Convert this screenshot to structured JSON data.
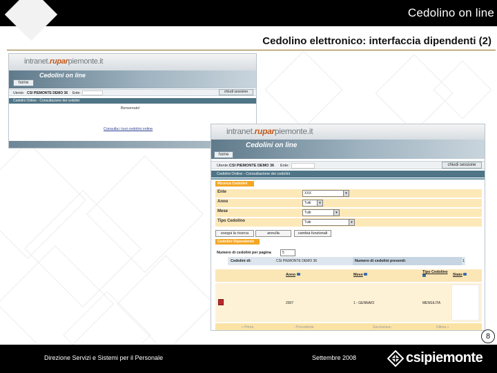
{
  "slide": {
    "header": "Cedolino on line",
    "title": "Cedolino elettronico: interfaccia dipendenti (2)",
    "page_number": "8"
  },
  "footer": {
    "left": "Direzione Servizi e Sistemi per il Personale",
    "center": "Settembre 2008",
    "logo": "csipiemonte"
  },
  "shot1": {
    "brand_pre": "intranet.",
    "brand_rupar": "rupar",
    "brand_post": "piemonte.it",
    "nav_title": "Cedolini on line",
    "home_tab": "home",
    "user_label": "Utente:",
    "user_value": "CSI PIEMONTE DEMO 36",
    "ente_label": "Ente:",
    "close_session": "chiudi sessione",
    "section": "Cedolini Online - Consultazione dei cedolini",
    "welcome": "Benvenuto!",
    "link": "Consulta i tuoi cedolini online"
  },
  "shot2": {
    "brand_pre": "intranet.",
    "brand_rupar": "rupar",
    "brand_post": "piemonte.it",
    "nav_title": "Cedolini on line",
    "home_tab": "home",
    "user_label": "Utente:",
    "user_value": "CSI PIEMONTE DEMO 36",
    "ente_label": "Ente:",
    "close_session": "chiudi sessione",
    "section": "Cedolini Online - Consultazione dei cedolini",
    "search_header": "Ricerca Cedolini",
    "fields": {
      "ente_label": "Ente",
      "ente_value": "XXX",
      "anno_label": "Anno",
      "anno_value": "Tutti",
      "mese_label": "Mese",
      "mese_value": "Tutti",
      "tipo_label": "Tipo Cedolino",
      "tipo_value": "Tutti"
    },
    "buttons": {
      "search": "esegui la ricerca",
      "cancel": "annulla",
      "change": "cambia funzionali"
    },
    "employee_header": "Cedolini Dipendente",
    "per_page_label": "Numero di cedolini per pagina",
    "per_page_value": "5",
    "summary": {
      "cedolini_label": "Cedolini di:",
      "cedolini_value": "CSI PIEMONTE DEMO 36",
      "count_label": "Numero di cedolini presenti:",
      "count_value": "1"
    },
    "table": {
      "headers": [
        "Anno",
        "Mese",
        "Tipo Cedolino",
        "Stato"
      ],
      "row": [
        "2007",
        "1 - GENNAIO",
        "MENSILITA",
        ""
      ]
    },
    "pager": [
      "« Prima",
      "‹ Precedente",
      "Successiva ›",
      "Ultima »"
    ]
  },
  "icons": [
    "pdf-icon",
    "sort-icon",
    "csipiemonte-logo-icon"
  ]
}
